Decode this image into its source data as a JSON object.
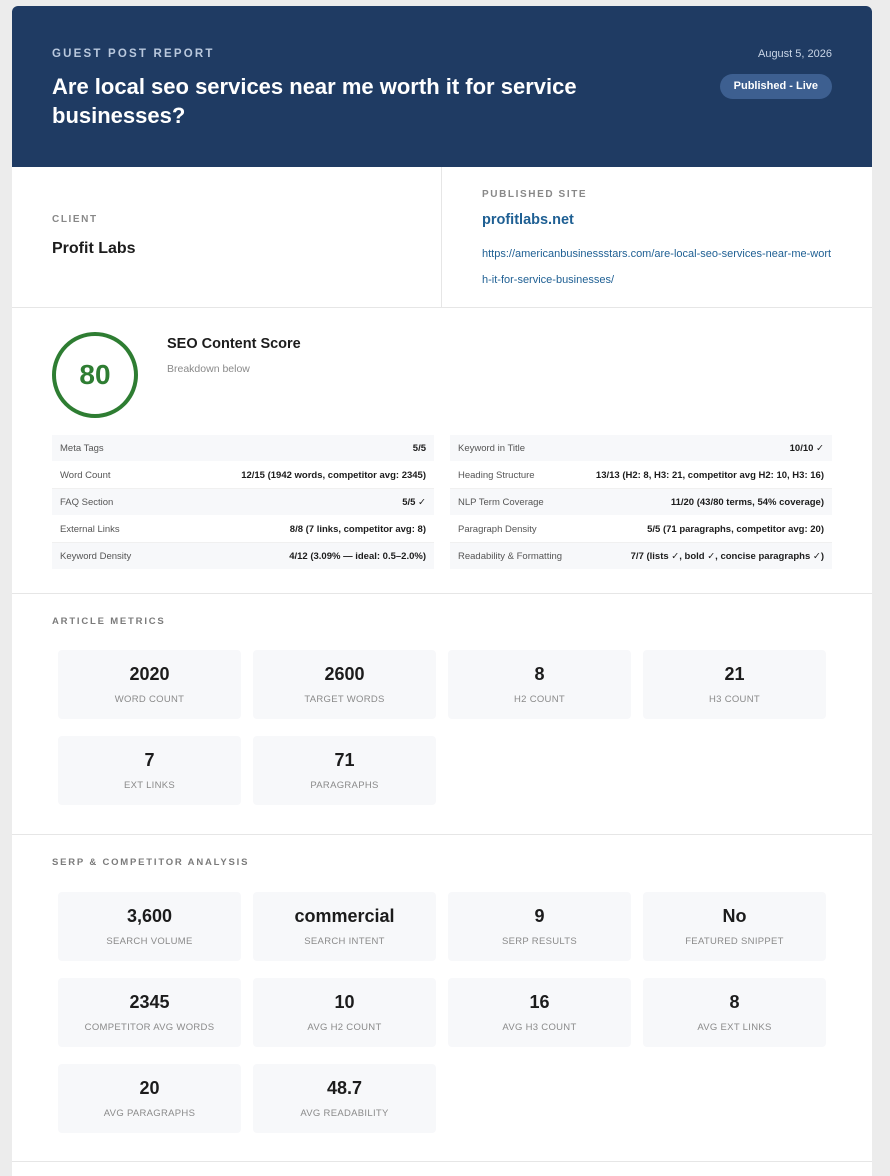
{
  "header": {
    "kicker": "GUEST POST REPORT",
    "title": "Are local seo services near me worth it for service businesses?",
    "date": "August 5, 2026",
    "status": "Published - Live"
  },
  "client": {
    "label": "CLIENT",
    "name": "Profit Labs"
  },
  "site": {
    "label": "PUBLISHED SITE",
    "name": "profitlabs.net",
    "url": "https://americanbusinessstars.com/are-local-seo-services-near-me-worth-it-for-service-businesses/"
  },
  "score": {
    "value": "80",
    "title": "SEO Content Score",
    "subtitle": "Breakdown below",
    "color": "#2e7d32",
    "left_rows": [
      {
        "label": "Meta Tags",
        "value": "5/5"
      },
      {
        "label": "Word Count",
        "value": "12/15 (1942 words, competitor avg: 2345)"
      },
      {
        "label": "FAQ Section",
        "value": "5/5 ✓"
      },
      {
        "label": "External Links",
        "value": "8/8 (7 links, competitor avg: 8)"
      },
      {
        "label": "Keyword Density",
        "value": "4/12 (3.09% — ideal: 0.5–2.0%)"
      }
    ],
    "right_rows": [
      {
        "label": "Keyword in Title",
        "value": "10/10 ✓"
      },
      {
        "label": "Heading Structure",
        "value": "13/13 (H2: 8, H3: 21, competitor avg H2: 10, H3: 16)"
      },
      {
        "label": "NLP Term Coverage",
        "value": "11/20 (43/80 terms, 54% coverage)"
      },
      {
        "label": "Paragraph Density",
        "value": "5/5 (71 paragraphs, competitor avg: 20)"
      },
      {
        "label": "Readability & Formatting",
        "value": "7/7 (lists ✓, bold ✓, concise paragraphs ✓)"
      }
    ]
  },
  "article_metrics": {
    "title": "ARTICLE METRICS",
    "tiles": [
      {
        "value": "2020",
        "label": "WORD COUNT"
      },
      {
        "value": "2600",
        "label": "TARGET WORDS"
      },
      {
        "value": "8",
        "label": "H2 COUNT"
      },
      {
        "value": "21",
        "label": "H3 COUNT"
      },
      {
        "value": "7",
        "label": "EXT LINKS"
      },
      {
        "value": "71",
        "label": "PARAGRAPHS"
      }
    ]
  },
  "serp": {
    "title": "SERP & COMPETITOR ANALYSIS",
    "tiles": [
      {
        "value": "3,600",
        "label": "SEARCH VOLUME"
      },
      {
        "value": "commercial",
        "label": "SEARCH INTENT"
      },
      {
        "value": "9",
        "label": "SERP RESULTS"
      },
      {
        "value": "No",
        "label": "FEATURED SNIPPET"
      },
      {
        "value": "2345",
        "label": "COMPETITOR AVG WORDS"
      },
      {
        "value": "10",
        "label": "AVG H2 COUNT"
      },
      {
        "value": "16",
        "label": "AVG H3 COUNT"
      },
      {
        "value": "8",
        "label": "AVG EXT LINKS"
      },
      {
        "value": "20",
        "label": "AVG PARAGRAPHS"
      },
      {
        "value": "48.7",
        "label": "AVG READABILITY"
      }
    ]
  }
}
